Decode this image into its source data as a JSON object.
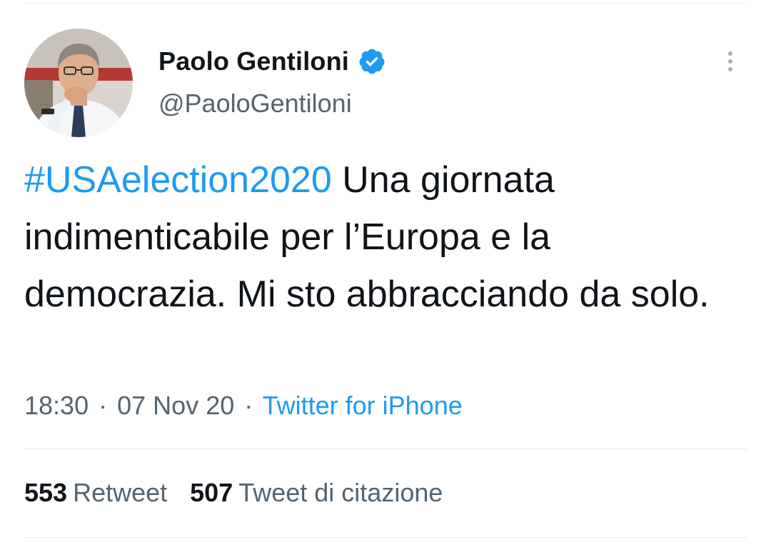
{
  "author": {
    "display_name": "Paolo Gentiloni",
    "handle": "@PaoloGentiloni",
    "verified": true,
    "avatar_icon": "profile-photo"
  },
  "tweet": {
    "hashtag": "#USAelection2020",
    "text_after_hashtag": " Una giornata indimenticabile per l’Europa e la democrazia. Mi sto abbracciando da solo."
  },
  "meta": {
    "time": "18:30",
    "separator": "·",
    "date": "07 Nov 20",
    "source": "Twitter for iPhone"
  },
  "stats": {
    "retweet_count": "553",
    "retweet_label": "Retweet",
    "quote_count": "507",
    "quote_label": "Tweet di citazione"
  },
  "colors": {
    "accent": "#1d9bf0",
    "text_primary": "#0f1419",
    "text_secondary": "#536471",
    "divider": "#e4e8ea"
  },
  "icons": {
    "verified": "verified-badge-icon",
    "more": "more-options-icon"
  }
}
